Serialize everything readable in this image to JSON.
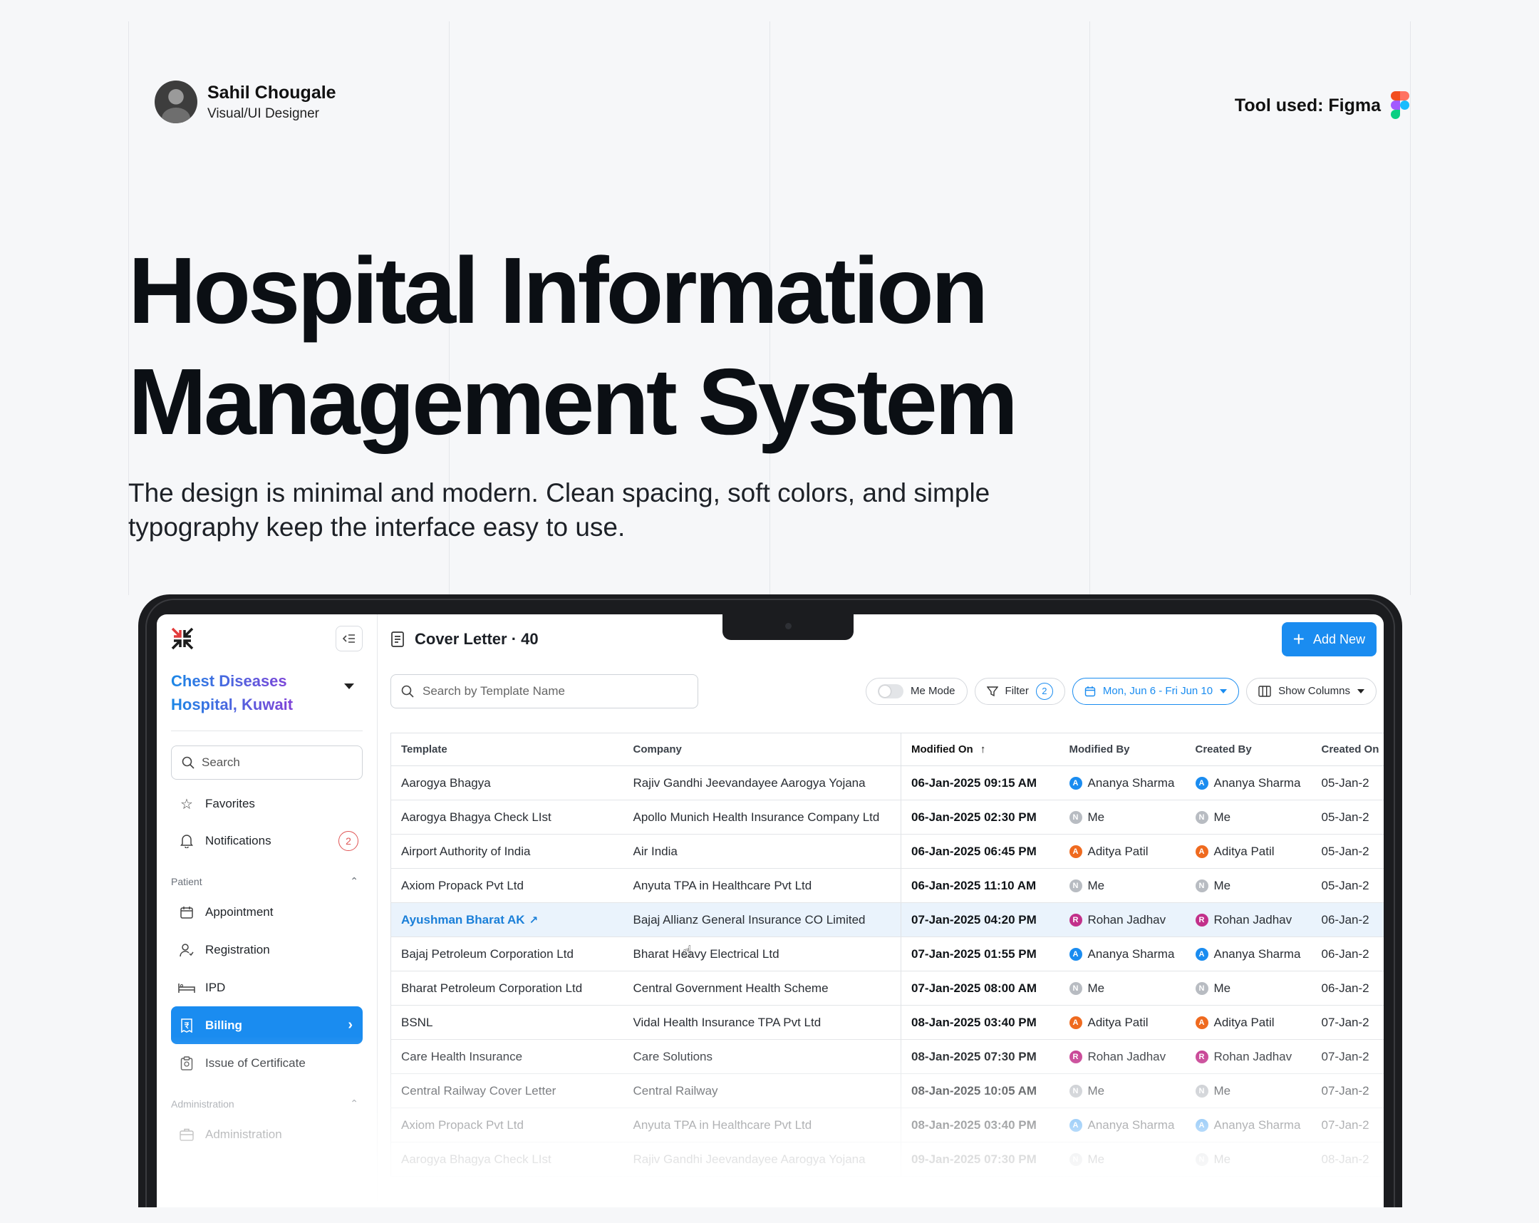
{
  "author": {
    "name": "Sahil Chougale",
    "role": "Visual/UI Designer"
  },
  "tool_used": "Tool used: Figma",
  "hero": {
    "line1": "Hospital Information",
    "line2": "Management System",
    "subtitle": "The design is minimal and modern. Clean spacing, soft colors, and simple typography keep the interface easy to use."
  },
  "sidebar": {
    "hospital": "Chest Diseases Hospital, Kuwait",
    "search_placeholder": "Search",
    "favorites": "Favorites",
    "notifications": "Notifications",
    "notifications_count": "2",
    "section_patient": "Patient",
    "items": [
      "Appointment",
      "Registration",
      "IPD",
      "Billing",
      "Issue of Certificate"
    ],
    "section_admin": "Administration",
    "admin_items": [
      "Administration"
    ]
  },
  "header": {
    "title": "Cover Letter · 40",
    "add_new": "Add New"
  },
  "toolbar": {
    "search_placeholder": "Search by Template Name",
    "me_mode": "Me Mode",
    "filter": "Filter",
    "filter_count": "2",
    "date_range": "Mon, Jun 6 - Fri Jun 10",
    "show_columns": "Show Columns"
  },
  "table": {
    "columns": [
      "Template",
      "Company",
      "Modified On",
      "Modified By",
      "Created By",
      "Created On"
    ],
    "rows": [
      {
        "template": "Aarogya Bhagya",
        "company": "Rajiv Gandhi Jeevandayee Aarogya Yojana",
        "modified_on": "06-Jan-2025 09:15 AM",
        "modified_by": "Ananya Sharma",
        "created_by": "Ananya Sharma",
        "created_on": "05-Jan-2",
        "initial": "A",
        "color": "#1a8cf0"
      },
      {
        "template": "Aarogya Bhagya Check LIst",
        "company": "Apollo Munich Health Insurance Company Ltd",
        "modified_on": "06-Jan-2025 02:30 PM",
        "modified_by": "Me",
        "created_by": "Me",
        "created_on": "05-Jan-2",
        "initial": "N",
        "color": "#b8bcc2"
      },
      {
        "template": "Airport Authority of India",
        "company": "Air India",
        "modified_on": "06-Jan-2025 06:45 PM",
        "modified_by": "Aditya Patil",
        "created_by": "Aditya Patil",
        "created_on": "05-Jan-2",
        "initial": "A",
        "color": "#ef6a1f"
      },
      {
        "template": "Axiom Propack Pvt Ltd",
        "company": "Anyuta TPA in Healthcare Pvt Ltd",
        "modified_on": "06-Jan-2025 11:10 AM",
        "modified_by": "Me",
        "created_by": "Me",
        "created_on": "05-Jan-2",
        "initial": "N",
        "color": "#b8bcc2"
      },
      {
        "template": "Ayushman Bharat AK",
        "company": "Bajaj Allianz General Insurance CO Limited",
        "modified_on": "07-Jan-2025 04:20 PM",
        "modified_by": "Rohan Jadhav",
        "created_by": "Rohan Jadhav",
        "created_on": "06-Jan-2",
        "initial": "R",
        "color": "#c2308a"
      },
      {
        "template": "Bajaj Petroleum Corporation Ltd",
        "company": "Bharat Heavy Electrical Ltd",
        "modified_on": "07-Jan-2025 01:55 PM",
        "modified_by": "Ananya Sharma",
        "created_by": "Ananya Sharma",
        "created_on": "06-Jan-2",
        "initial": "A",
        "color": "#1a8cf0"
      },
      {
        "template": "Bharat Petroleum Corporation Ltd",
        "company": "Central Government Health Scheme",
        "modified_on": "07-Jan-2025 08:00 AM",
        "modified_by": "Me",
        "created_by": "Me",
        "created_on": "06-Jan-2",
        "initial": "N",
        "color": "#b8bcc2"
      },
      {
        "template": "BSNL",
        "company": "Vidal Health Insurance TPA Pvt Ltd",
        "modified_on": "08-Jan-2025 03:40 PM",
        "modified_by": "Aditya Patil",
        "created_by": "Aditya Patil",
        "created_on": "07-Jan-2",
        "initial": "A",
        "color": "#ef6a1f"
      },
      {
        "template": "Care Health Insurance",
        "company": "Care Solutions",
        "modified_on": "08-Jan-2025 07:30 PM",
        "modified_by": "Rohan Jadhav",
        "created_by": "Rohan Jadhav",
        "created_on": "07-Jan-2",
        "initial": "R",
        "color": "#c2308a"
      },
      {
        "template": "Central Railway Cover Letter",
        "company": "Central Railway",
        "modified_on": "08-Jan-2025 10:05 AM",
        "modified_by": "Me",
        "created_by": "Me",
        "created_on": "07-Jan-2",
        "initial": "N",
        "color": "#b8bcc2"
      },
      {
        "template": "Axiom Propack Pvt Ltd",
        "company": "Anyuta TPA in Healthcare Pvt Ltd",
        "modified_on": "08-Jan-2025 03:40 PM",
        "modified_by": "Ananya Sharma",
        "created_by": "Ananya Sharma",
        "created_on": "07-Jan-2",
        "initial": "A",
        "color": "#1a8cf0"
      },
      {
        "template": "Aarogya Bhagya Check LIst",
        "company": "Rajiv Gandhi Jeevandayee Aarogya Yojana",
        "modified_on": "09-Jan-2025 07:30 PM",
        "modified_by": "Me",
        "created_by": "Me",
        "created_on": "08-Jan-2",
        "initial": "N",
        "color": "#b8bcc2"
      }
    ]
  },
  "colors": {
    "accent": "#1a8cf0",
    "highlight_row": "#eaf3fc"
  }
}
